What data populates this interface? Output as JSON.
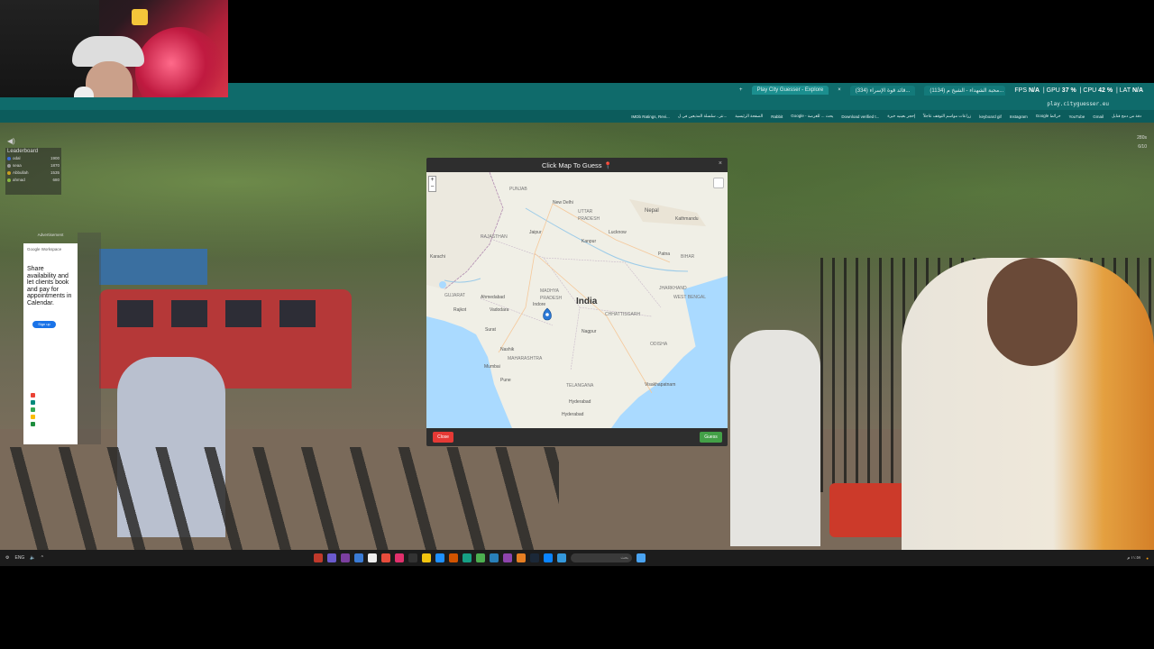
{
  "browser": {
    "tabs": [
      {
        "label": "Play City Guesser - Explore"
      },
      {
        "label": "(334) قائد قوة الإسراء..."
      },
      {
        "label": "(1134) محبة الشهداء - الشيخ م..."
      }
    ],
    "perf": {
      "fps_label": "FPS",
      "fps": "N/A",
      "gpu_label": "GPU",
      "gpu": "37 %",
      "cpu_label": "CPU",
      "cpu": "42 %",
      "lat_label": "LAT",
      "lat": "N/A"
    },
    "url": "play.cityguesser.eu",
    "bookmarks": [
      "IMDb Ratings, Revi...",
      "نتر.. سلسلة المذيعين في ل...",
      "الصفحة الرئيسية",
      "Rabbit",
      "Google - يحث ... للغرصة",
      "Download verified t...",
      "إحجز بعينيه خبرة",
      "زراعات مواسم التوقف عاجلاً",
      "keyboard gif",
      "Instagram",
      "Google خرائط",
      "YouTube",
      "Gmail",
      "دقة من دمج قنابل"
    ]
  },
  "leaderboard": {
    "title": "Leaderboard",
    "rows": [
      {
        "name": "odal",
        "score": "1900"
      },
      {
        "name": "seaa",
        "score": "1870"
      },
      {
        "name": "Abbullah",
        "score": "1535"
      },
      {
        "name": "ahmad",
        "score": "680"
      }
    ]
  },
  "ad": {
    "label": "Advertisement",
    "brand": "Google Workspace",
    "text": "Share availability and let clients book and pay for appointments in Calendar.",
    "button": "Sign up"
  },
  "hud": {
    "time": "280s",
    "round": "6/10"
  },
  "modal": {
    "title": "Click Map To Guess",
    "close_x": "×",
    "close_button": "Close",
    "guess_button": "Guess",
    "map": {
      "country": "India",
      "labels": [
        {
          "text": "PUNJAB"
        },
        {
          "text": "New Delhi"
        },
        {
          "text": "UTTAR"
        },
        {
          "text": "PRADESH"
        },
        {
          "text": "Nepal"
        },
        {
          "text": "Kathmandu"
        },
        {
          "text": "RAJASTHAN"
        },
        {
          "text": "Jaipur"
        },
        {
          "text": "Lucknow"
        },
        {
          "text": "Kanpur"
        },
        {
          "text": "Patna"
        },
        {
          "text": "BIHAR"
        },
        {
          "text": "MADHYA"
        },
        {
          "text": "PRADESH"
        },
        {
          "text": "JHARKHAND"
        },
        {
          "text": "WEST BENGAL"
        },
        {
          "text": "GUJARAT"
        },
        {
          "text": "Ahmedabad"
        },
        {
          "text": "Vadodara"
        },
        {
          "text": "Rajkot"
        },
        {
          "text": "Indore"
        },
        {
          "text": "Surat"
        },
        {
          "text": "Nagpur"
        },
        {
          "text": "CHHATTISGARH"
        },
        {
          "text": "ODISHA"
        },
        {
          "text": "Nashik"
        },
        {
          "text": "MAHARASHTRA"
        },
        {
          "text": "Mumbai"
        },
        {
          "text": "Pune"
        },
        {
          "text": "TELANGANA"
        },
        {
          "text": "Hyderabad"
        },
        {
          "text": "Visakhapatnam"
        },
        {
          "text": "Karachi"
        },
        {
          "text": "Hyderabad"
        }
      ]
    }
  },
  "taskbar": {
    "search_placeholder": "بحث",
    "left_time": "ENG",
    "right_date": "١١:٥٧ م"
  }
}
